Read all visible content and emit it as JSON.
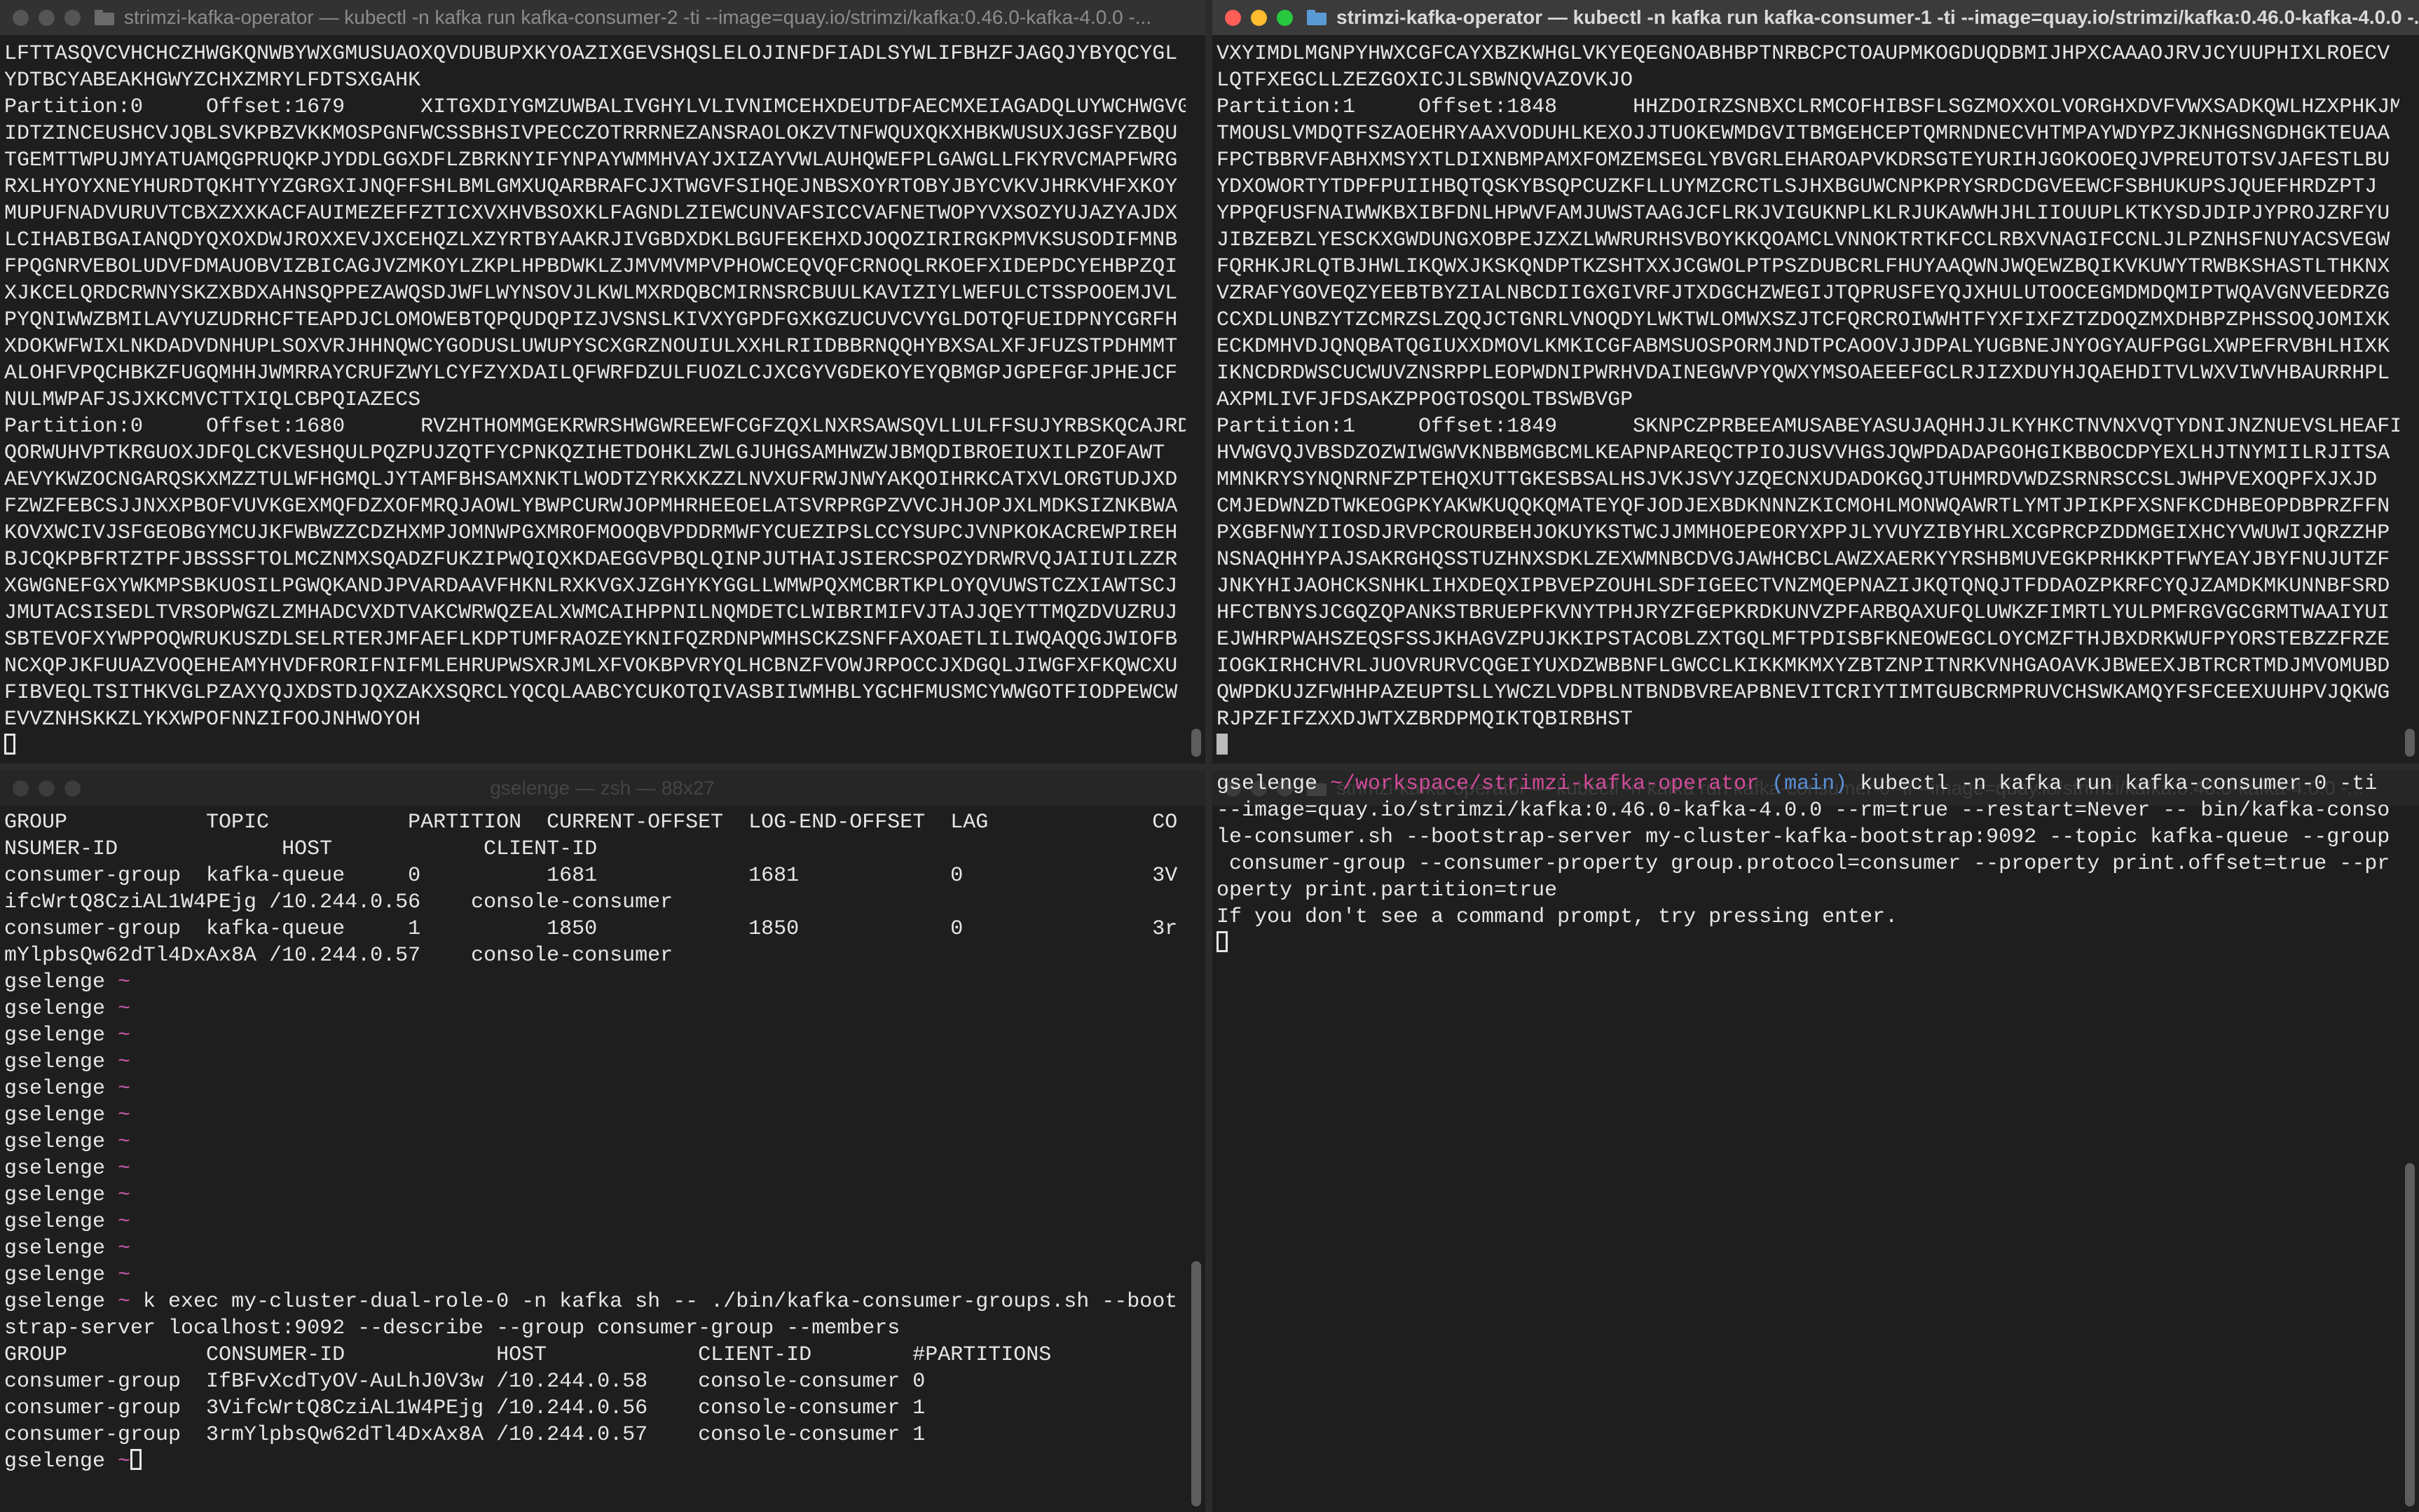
{
  "windows": {
    "top_left": {
      "title": "strimzi-kafka-operator — kubectl -n kafka run kafka-consumer-2 -ti --image=quay.io/strimzi/kafka:0.46.0-kafka-4.0.0 -...",
      "lines": [
        "LFTTASQVCVHCHCZHWGKQNWBYWXGMUSUAOXQVDUBUPXKYOAZIXGEVSHQSLELOJINFDFIADLSYWLIFBHZFJAGQJYBYQCYGL",
        "YDTBCYABEAKHGWYZCHXZMRYLFDTSXGAHK",
        "Partition:0     Offset:1679      XITGXDIYGMZUWBALIVGHYLVLIVNIMCEHXDEUTDFAECMXEIAGADQLUYWCHWGVG",
        "IDTZINCEUSHCVJQBLSVKPBZVKKMOSPGNFWCSSBHSIVPECCZOTRRRNEZANSRAOLOKZVTNFWQUXQKXHBKWUSUXJGSFYZBQU",
        "TGEMTTWPUJMYATUAMQGPRUQKPJYDDLGGXDFLZBRKNYIFYNPAYWMMHVAYJXIZAYVWLAUHQWEFPLGAWGLLFKYRVCMAPFWRG",
        "RXLHYOYXNEYHURDTQKHTYYZGRGXIJNQFFSHLBMLGMXUQARBRAFCJXTWGVFSIHQEJNBSXOYRTOBYJBYCVKVJHRKVHFXKOY",
        "MUPUFNADVURUVTCBXZXXKACFAUIMEZEFFZTICXVXHVBSOXKLFAGNDLZIEWCUNVAFSICCVAFNETWOPYVXSOZYUJAZYAJDX",
        "LCIHABIBGAIANQDYQXOXDWJROXXEVJXCEHQZLXZYRTBYAAKRJIVGBDXDKLBGUFEKEHXDJOQOZIRIRGKPMVKSUSODIFMNB",
        "FPQGNRVEBOLUDVFDMAUOBVIZBICAGJVZMKOYLZKPLHPBDWKLZJMVMVMPVPHOWCEQVQFCRNOQLRKOEFXIDEPDCYEHBPZQI",
        "XJKCELQRDCRWNYSKZXBDXAHNSQPPEZAWQSDJWFLWYNSOVJLKWLMXRDQBCMIRNSRCBUULKAVIZIYLWEFULCTSSPOOEMJVL",
        "PYQNIWWZBMILAVYUZUDRHCFTEAPDJCLOMOWEBTQPQUDQPIZJVSNSLKIVXYGPDFGXKGZUCUVCVYGLDOTQFUEIDPNYCGRFH",
        "XDOKWFWIXLNKDADVDNHUPLSOXVRJHHNQWCYGODUSLUWUPYSCXGRZNOUIULXXHLRIIDBBRNQQHYBXSALXFJFUZSTPDHMMT",
        "ALOHFVPQCHBKZFUGQMHHJWMRRAYCRUFZWYLCYFZYXDAILQFWRFDZULFUOZLCJXCGYVGDEKOYEYQBMGPJGPEFGFJPHEJCF",
        "NULMWPAFJSJXKCMVCTTXIQLCBPQIAZECS",
        "Partition:0     Offset:1680      RVZHTHOMMGEKRWRSHWGWREEWFCGFZQXLNXRSAWSQVLLULFFSUJYRBSKQCAJRD",
        "QORWUHVPTKRGUOXJDFQLCKVESHQULPQZPUJZQTFYCPNKQZIHETDOHKLZWLGJUHGSAMHWZWJBMQDIBROEIUXILPZOFAWT",
        "AEVYKWZOCNGARQSKXMZZTULWFHGMQLJYTAMFBHSAMXNKTLWODTZYRKXKZZLNVXUFRWJNWYAKQOIHRKCATXVLORGTUDJXD",
        "FZWZFEBCSJJNXXPBOFVUVKGEXMQFDZXOFMRQJAOWLYBWPCURWJOPMHRHEEOELATSVRPRGPZVVCJHJOPJXLMDKSIZNKBWA",
        "KOVXWCIVJSFGEOBGYMCUJKFWBWZZCDZHXMPJOMNWPGXMROFMOOQBVPDDRMWFYCUEZIPSLCCYSUPCJVNPKOKACREWPIREH",
        "BJCQKPBFRTZTPFJBSSSFTOLMCZNMXSQADZFUKZIPWQIQXKDAEGGVPBQLQINPJUTHAIJSIERCSPOZYDRWRVQJAIIUILZZR",
        "XGWGNEFGXYWKMPSBKUOSILPGWQKANDJPVARDAAVFHKNLRXKVGXJZGHYKYGGLLWMWPQXMCBRTKPLOYQVUWSTCZXIAWTSCJ",
        "JMUTACSISEDLTVRSOPWGZLZMHADCVXDTVAKCWRWQZEALXWMCAIHPPNILNQMDETCLWIBRIMIFVJTAJJQEYTTMQZDVUZRUJ",
        "SBTEVOFXYWPPOQWRUKUSZDLSELRTERJMFAEFLKDPTUMFRAOZEYKNIFQZRDNPWMHSCKZSNFFAXOAETLILIWQAQQGJWIOFB",
        "NCXQPJKFUUAZVOQEHEAMYHVDFRORIFNIFMLEHRUPWSXRJMLXFVOKBPVRYQLHCBNZFVOWJRPOCCJXDGQLJIWGFXFKQWCXU",
        "FIBVEQLTSITHKVGLPZAXYQJXDSTDJQXZAKXSQRCLYQCQLAABCYCUKOTQIVASBIIWMHBLYGCHFMUSMCYWWGOTFIODPEWCW",
        "EVVZNHSKKZLYKXWPOFNNZIFOOJNHWOYOH"
      ]
    },
    "top_right": {
      "title": "strimzi-kafka-operator — kubectl -n kafka run kafka-consumer-1 -ti --image=quay.io/strimzi/kafka:0.46.0-kafka-4.0.0 -...",
      "lines": [
        "VXYIMDLMGNPYHWXCGFCAYXBZKWHGLVKYEQEGNOABHBPTNRBCPCTOAUPMKOGDUQDBMIJHPXCAAAOJRVJCYUUPHIXLROECV",
        "LQTFXEGCLLZEZGOXICJLSBWNQVAZOVKJO",
        "Partition:1     Offset:1848      HHZDOIRZSNBXCLRMCOFHIBSFLSGZMOXXOLVORGHXDVFVWXSADKQWLHZXPHKJM",
        "TMOUSLVMDQTFSZAOEHRYAAXVODUHLKEXOJJTUOKEWMDGVITBMGEHCEPTQMRNDNECVHTMPAYWDYPZJKNHGSNGDHGKTEUAA",
        "FPCTBBRVFABHXMSYXTLDIXNBMPAMXFOMZEMSEGLYBVGRLEHAROAPVKDRSGTEYURIHJGOKOOEQJVPREUTOTSVJAFESTLBU",
        "YDXOWORTYTDPFPUIIHBQTQSKYBSQPCUZKFLLUYMZCRCTLSJHXBGUWCNPKPRYSRDCDGVEEWCFSBHUKUPSJQUEFHRDZPTJ",
        "YPPQFUSFNAIWWKBXIBFDNLHPWVFAMJUWSTAAGJCFLRKJVIGUKNPLKLRJUKAWWHJHLIIOUUPLKTKYSDJDIPJYPROJZRFYU",
        "JIBZEBZLYESCKXGWDUNGXOBPEJZXZLWWRURHSVBOYKKQOAMCLVNNOKTRTKFCCLRBXVNAGIFCCNLJLPZNHSFNUYACSVEGW",
        "FQRHKJRLQTBJHWLIKQWXJKSKQNDPTKZSHTXXJCGWOLPTPSZDUBCRLFHUYAAQWNJWQEWZBQIKVKUWYTRWBKSHASTLTHKNX",
        "VZRAFYGOVEQZYEEBTBYZIALNBCDIIGXGIVRFJTXDGCHZWEGIJTQPRUSFEYQJXHULUTOOCEGMDMDQMIPTWQAVGNVEEDRZG",
        "CCXDLUNBZYTZCMRZSLZQQJCTGNRLVNOQDYLWKTWLOMWXSZJTCFQRCROIWWHTFYXFIXFZTZDOQZMXDHBPZPHSSOQJOMIXK",
        "ECKDMHVDJQNQBATQGIUXXDMOVLKMKICGFABMSUOSPORMJNDTPCAOOVJJDPALYUGBNEJNYOGYAUFPGGLXWPEFRVBHLHIXK",
        "IKNCDRDWSCUCWUVZNSRPPLEOPWDNIPWRHVDAINEGWVPYQWXYMSOAEEEFGCLRJIZXDUYHJQAEHDITVLWXVIWVHBAURRHPL",
        "AXPMLIVFJFDSAKZPPOGTOSQOLTBSWBVGP",
        "Partition:1     Offset:1849      SKNPCZPRBEEAMUSABEYASUJAQHHJJLKYHKCTNVNXVQTYDNIJNZNUEVSLHEAFI",
        "HVWGVQJVBSDZOZWIWGWVKNBBMGBCMLKEAPNPAREQCTPIOJUSVVHGSJQWPDADAPGOHGIKBBOCDPYEXLHJTNYMIILRJITSA",
        "MMNKRYSYNQNRNFZPTEHQXUTTGKESBSALHSJVKJSVYJZQECNXUDADOKGQJTUHMRDVWDZSRNRSCCSLJWHPVEXOQPFXJXJD",
        "CMJEDWNZDTWKEOGPKYAKWKUQQKQMATEYQFJODJEXBDKNNNZKICMOHLMONWQAWRTLYMTJPIKPFXSNFKCDHBEOPDBPRZFFN",
        "PXGBFNWYIIOSDJRVPCROURBEHJOKUYKSTWCJJMMHOEPEORYXPPJLYVUYZIBYHRLXCGPRCPZDDMGEIXHCYVWUWIJQRZZHP",
        "NSNAQHHYPAJSAKRGHQSSTUZHNXSDKLZEXWMNBCDVGJAWHCBCLAWZXAERKYYRSHBMUVEGKPRHKKPTFWYEAYJBYFNUJUTZF",
        "JNKYHIJAOHCKSNHKLIHXDEQXIPBVEPZOUHLSDFIGEECTVNZMQEPNAZIJKQTQNQJTFDDAOZPKRFCYQJZAMDKMKUNNBFSRD",
        "HFCTBNYSJCGQZQPANKSTBRUEPFKVNYTPHJRYZFGEPKRDKUNVZPFARBQAXUFQLUWKZFIMRTLYULPMFRGVGCGRMTWAAIYUI",
        "EJWHRPWAHSZEQSFSSJKHAGVZPUJKKIPSTACOBLZXTGQLMFTPDISBFKNEOWEGCLOYCMZFTHJBXDRKWUFPYORSTEBZZFRZE",
        "IOGKIRHCHVRLJUOVRURVCQGEIYUXDZWBBNFLGWCCLKIKKMKMXYZBTZNPITNRKVNHGAOAVKJBWEEXJBTRCRTMDJMVOMUBD",
        "QWPDKUJZFWHHPAZEUPTSLLYWCZLVDPBLNTBNDBVREAPBNEVITCRIYTIMTGUBCRMPRUVCHSWKAMQYFSFCEEXUUHPVJQKWG",
        "RJPZFIFZXXDJWTXZBRDPMQIKTQBIRBHST"
      ]
    },
    "bottom_left": {
      "title": "gselenge — zsh — 88x27",
      "table1_header": "GROUP           TOPIC           PARTITION  CURRENT-OFFSET  LOG-END-OFFSET  LAG             CO",
      "table1_header2": "NSUMER-ID             HOST            CLIENT-ID",
      "table1_rows": [
        "consumer-group  kafka-queue     0          1681            1681            0               3V",
        "ifcWrtQ8CziAL1W4PEjg /10.244.0.56    console-consumer",
        "consumer-group  kafka-queue     1          1850            1850            0               3r",
        "mYlpbsQw62dTl4DxAx8A /10.244.0.57    console-consumer"
      ],
      "prompt_user": "gselenge",
      "prompt_dir": "~",
      "empty_prompt_count": 12,
      "command": "k exec my-cluster-dual-role-0 -n kafka sh -- ./bin/kafka-consumer-groups.sh --boot",
      "command_cont": "strap-server localhost:9092 --describe --group consumer-group --members",
      "table2_header": "GROUP           CONSUMER-ID            HOST            CLIENT-ID        #PARTITIONS",
      "table2_rows": [
        "consumer-group  IfBFvXcdTyOV-AuLhJ0V3w /10.244.0.58    console-consumer 0",
        "consumer-group  3VifcWrtQ8CziAL1W4PEjg /10.244.0.56    console-consumer 1",
        "consumer-group  3rmYlpbsQw62dTl4DxAx8A /10.244.0.57    console-consumer 1"
      ]
    },
    "bottom_right": {
      "title": "strimzi-kafka-operator — kubectl -n kafka run kafka-consumer-0 -ti --image=quay.io/strimzi/kafka:0.46.0-kafka-4.0.0 -...",
      "prompt_user": "gselenge",
      "prompt_path": "~/workspace/strimzi-kafka-operator",
      "prompt_branch": "(main)",
      "command_first": "kubectl -n kafka run kafka-consumer-0 -ti",
      "command_lines": [
        "--image=quay.io/strimzi/kafka:0.46.0-kafka-4.0.0 --rm=true --restart=Never -- bin/kafka-conso",
        "le-consumer.sh --bootstrap-server my-cluster-kafka-bootstrap:9092 --topic kafka-queue --group",
        " consumer-group --consumer-property group.protocol=consumer --property print.offset=true --pr",
        "operty print.partition=true"
      ],
      "message": "If you don't see a command prompt, try pressing enter."
    }
  }
}
